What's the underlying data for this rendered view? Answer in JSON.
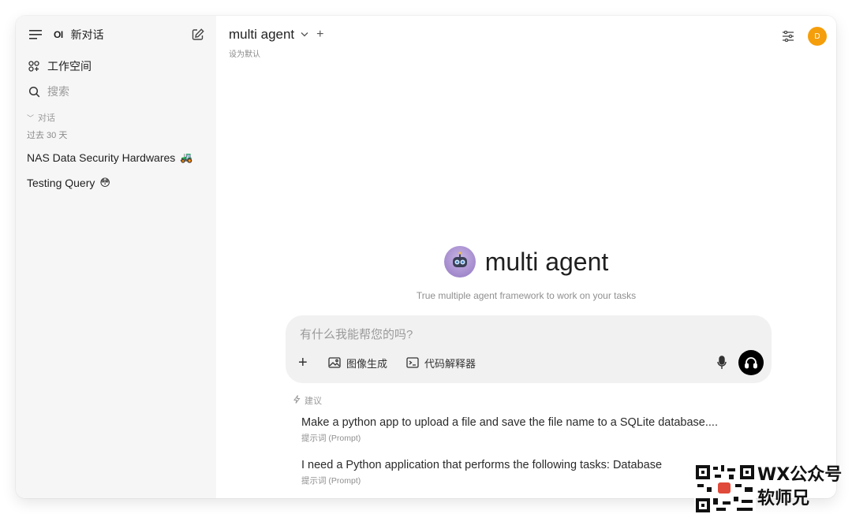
{
  "sidebar": {
    "logo": "OI",
    "new_chat": "新对话",
    "workspace": "工作空间",
    "search": "搜索",
    "section": "对话",
    "group": "过去 30 天",
    "chats": [
      {
        "title": "NAS Data Security Hardwares",
        "emoji": "🚜"
      },
      {
        "title": "Testing Query",
        "emoji": "😳"
      }
    ]
  },
  "header": {
    "model": "multi agent",
    "set_default": "设为默认",
    "avatar_initial": "D"
  },
  "hero": {
    "title": "multi agent",
    "subtitle": "True multiple agent framework to work on your tasks"
  },
  "composer": {
    "placeholder": "有什么我能帮您的吗?",
    "tools": [
      "图像生成",
      "代码解释器"
    ]
  },
  "suggestions": {
    "label": "建议",
    "items": [
      {
        "title": "Make a python app to upload a file and save the file name to a SQLite database....",
        "subtitle": "提示词 (Prompt)"
      },
      {
        "title": "I need a Python application that performs the following tasks: Database",
        "subtitle": "提示词 (Prompt)"
      }
    ]
  },
  "watermark": {
    "line1": "WX公众号",
    "line2": "软师兄"
  },
  "colors": {
    "accent_avatar": "#f59e0b",
    "sidebar_bg": "#f6f6f6",
    "composer_bg": "#f1f1f1"
  },
  "icons": [
    "menu-icon",
    "edit-icon",
    "workspace-icon",
    "search-icon",
    "chevron-down-icon",
    "plus-icon",
    "controls-icon",
    "image-icon",
    "terminal-icon",
    "mic-icon",
    "headphones-icon",
    "bolt-icon",
    "qr-code"
  ]
}
